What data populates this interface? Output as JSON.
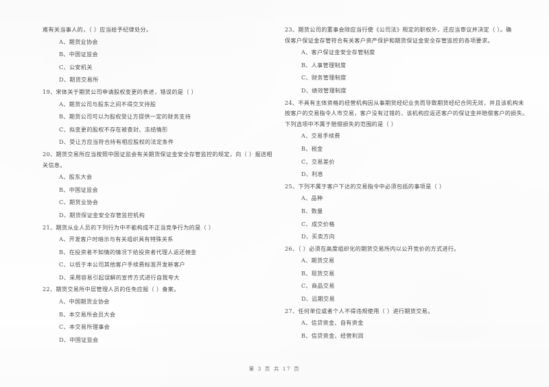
{
  "document": {
    "type": "exam-paper",
    "language": "zh-CN",
    "footer": "第 3 页 共 17 页"
  },
  "columns": {
    "left": [
      {
        "id": "q18-tail",
        "stem_lines": [
          "难有关当事人的，（      ）应当给予纪律处分。"
        ],
        "options": [
          "A、期货业协会",
          "B、中国证监会",
          "C、公安机关",
          "D、期货交易所"
        ]
      },
      {
        "id": "q19",
        "stem_lines": [
          "19、宋体关于期货公司申请股权变更的表述，错误的是（      ）"
        ],
        "options": [
          "A、期货公司与股东之间不得交叉持股",
          "B、期货公司可以为股权受让方提供一定的财务支持",
          "C、拟变更的股权不存在被查封、冻结情形",
          "D、受让方应当符合持有相应股权的法定条件"
        ]
      },
      {
        "id": "q20",
        "stem_lines": [
          "20、期货交易所应当按照中国证监会有关期货保证金安全存管监控的规定，向（      ）报送相",
          "关信息。"
        ],
        "options": [
          "A、股东大会",
          "B、中国证监会",
          "C、期货业协会",
          "D、期货保证金安全存管监控机构"
        ]
      },
      {
        "id": "q21",
        "stem_lines": [
          "21、期货从业人员的下列行为中不能构成不正当竞争行为的是（      ）"
        ],
        "options": [
          "A、开发客户时暗示与有关组织具有特殊关系",
          "B、在投资者不知情的情况下给投资者代理人返还佣金",
          "C、以低于本公司其他客户手续费标准开发新客户",
          "D、采用容易引起误解的宣传方式进行自我夸大"
        ]
      },
      {
        "id": "q22",
        "stem_lines": [
          "22、期货交易所中层管理人员的任免应报（      ）备案。"
        ],
        "options": [
          "A、中国期货业协会",
          "B、本交易所会员大会",
          "C、本交易所理事会",
          "D、中国证监会"
        ]
      }
    ],
    "right": [
      {
        "id": "q23",
        "stem_lines": [
          "23、期货公司的董事会除应当行使《公司法》规定的职权外，还应当审议并决定（      ）。确",
          "保客户保证金存管符合有关客户资产保护和期货保证金安全存管监控的各项要求。"
        ],
        "options": [
          "A、客户保证金安全存管制度",
          "B、人事管理制度",
          "C、财务管理制度",
          "D、绩效管理制度"
        ]
      },
      {
        "id": "q24",
        "stem_lines": [
          "24、不具有主体资格的经营机构因从事期货经纪业务而导致期货经纪合同无效，并且该机构未",
          "按客户的交易指令人市交易，客户没有过错的，该机构应返还客户的保证金并赔偿客户的损失。",
          "下列选项中不属于赔偿损失的范围的是（      ）"
        ],
        "options": [
          "A、交易手续费",
          "B、税金",
          "C、交易差价",
          "D、利息"
        ]
      },
      {
        "id": "q25",
        "stem_lines": [
          "25、下列不属于客户下达的交易指令中必须包括的事项是（      ）"
        ],
        "options": [
          "A、品种",
          "B、数量",
          "C、成交价格",
          "D、买卖方向"
        ]
      },
      {
        "id": "q26",
        "stem_lines": [
          "26、（      ）必须在高度组织化的期货交易所内以公开竞价的方式进行。"
        ],
        "options": [
          "A、期货交易",
          "B、现货交易",
          "C、商品交易",
          "D、远期交易"
        ]
      },
      {
        "id": "q27",
        "stem_lines": [
          "27、任何单位或者个人不得违规使用（      ）进行期货交易。"
        ],
        "options": [
          "A、信贷资金、自有资金",
          "B、信贷资金、经营利润"
        ]
      }
    ]
  }
}
